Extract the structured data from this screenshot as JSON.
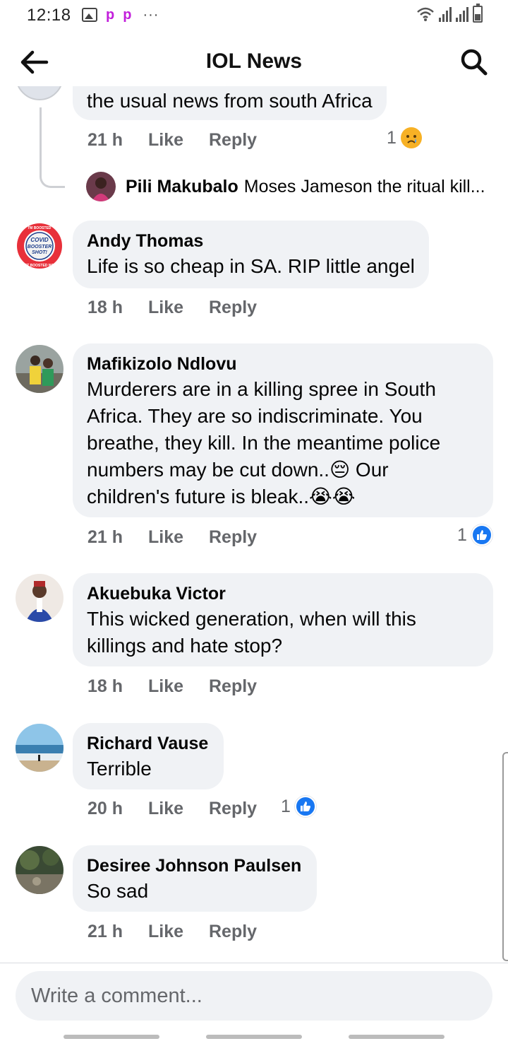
{
  "status_bar": {
    "time": "12:18",
    "dots": "···"
  },
  "header": {
    "title": "IOL News"
  },
  "previous_comment": {
    "text": "the usual news from south Africa",
    "time": "21 h",
    "like_label": "Like",
    "reply_label": "Reply",
    "reaction_count": "1",
    "reaction_type": "sad",
    "nested_reply": {
      "author": "Pili Makubalo",
      "text": "Moses Jameson the ritual kill..."
    }
  },
  "comments": [
    {
      "author": "Andy Thomas",
      "lines": [
        "Life is so cheap in SA. RIP little angel"
      ],
      "time": "18 h",
      "like_label": "Like",
      "reply_label": "Reply",
      "reaction_count": "",
      "avatar_text": [
        "I'M BOOSTED",
        "COVID",
        "BOOSTER",
        "SHOT!",
        "GET BOOSTED NOW"
      ]
    },
    {
      "author": "Mafikizolo Ndlovu",
      "lines": [
        "Murderers are in a killing spree in South",
        "Africa. They are so indiscriminate. You",
        "breathe, they kill. In the meantime police",
        "numbers may be cut down..😔 Our",
        "children's future is bleak..😭😭"
      ],
      "time": "21 h",
      "like_label": "Like",
      "reply_label": "Reply",
      "reaction_count": "1",
      "reaction_type": "like"
    },
    {
      "author": "Akuebuka Victor",
      "lines": [
        "This wicked generation, when will this",
        "killings and hate stop?"
      ],
      "time": "18 h",
      "like_label": "Like",
      "reply_label": "Reply",
      "reaction_count": ""
    },
    {
      "author": "Richard Vause",
      "lines": [
        "Terrible"
      ],
      "time": "20 h",
      "like_label": "Like",
      "reply_label": "Reply",
      "reaction_count": "1",
      "reaction_type": "like"
    },
    {
      "author": "Desiree Johnson Paulsen",
      "lines": [
        "So sad"
      ],
      "time": "21 h",
      "like_label": "Like",
      "reply_label": "Reply",
      "reaction_count": ""
    }
  ],
  "composer": {
    "placeholder": "Write a comment..."
  },
  "colors": {
    "like_blue": "#1877f2",
    "bubble_bg": "#f0f2f5",
    "meta_gray": "#65676b"
  }
}
